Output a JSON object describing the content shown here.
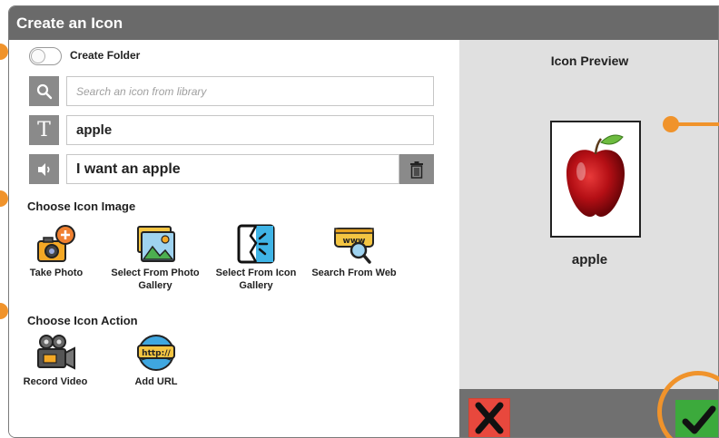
{
  "dialog": {
    "title": "Create an Icon"
  },
  "form": {
    "create_folder_label": "Create Folder",
    "create_folder_on": false,
    "search_placeholder": "Search an icon from library",
    "icon_name": "apple",
    "speak_text": "I want an apple",
    "text_icon_glyph": "T"
  },
  "choose_image": {
    "heading": "Choose Icon Image",
    "options": [
      {
        "label_line1": "Take Photo",
        "label_line2": "",
        "icon": "camera-add-icon"
      },
      {
        "label_line1": "Select From Photo",
        "label_line2": "Gallery",
        "icon": "photo-gallery-icon"
      },
      {
        "label_line1": "Select From Icon",
        "label_line2": "Gallery",
        "icon": "icon-gallery-icon"
      },
      {
        "label_line1": "Search From Web",
        "label_line2": "",
        "icon": "web-search-icon"
      }
    ]
  },
  "choose_action": {
    "heading": "Choose Icon Action",
    "options": [
      {
        "label": "Record Video",
        "icon": "video-camera-icon"
      },
      {
        "label": "Add URL",
        "icon": "url-globe-icon"
      }
    ]
  },
  "preview": {
    "title": "Icon Preview",
    "label": "apple",
    "image": "apple-image"
  },
  "colors": {
    "titlebar": "#6a6a6a",
    "panel": "#e0e0e0",
    "cancel": "#e8483d",
    "confirm": "#3caa3c",
    "marker": "#f0932b"
  }
}
